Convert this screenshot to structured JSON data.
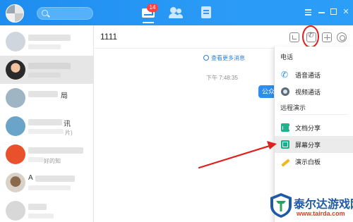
{
  "topbar": {
    "badge_count": "14",
    "accent": "#1e8df0"
  },
  "sidebar": {
    "items": [
      {
        "name": "",
        "subtitle": "",
        "selected": false
      },
      {
        "name": "",
        "subtitle": "",
        "selected": true
      },
      {
        "name": "局",
        "subtitle": "",
        "selected": false
      },
      {
        "name": "讯",
        "subtitle": "片)",
        "selected": false
      },
      {
        "name": "",
        "subtitle": "好的知",
        "selected": false
      },
      {
        "name": "A",
        "subtitle": "",
        "selected": false
      },
      {
        "name": "",
        "subtitle": "",
        "selected": false
      }
    ]
  },
  "chat": {
    "title": "1111",
    "more_messages": "查看更多消息",
    "timestamp": "下午 7:48:35",
    "bubble_text": "公众"
  },
  "menu": {
    "sections": [
      {
        "title": "电话",
        "items": [
          {
            "label": "语音通话",
            "icon": "phone-icon"
          },
          {
            "label": "视频通话",
            "icon": "video-camera-icon"
          }
        ]
      },
      {
        "title": "远程演示",
        "items": [
          {
            "label": "文档分享",
            "icon": "document-share-icon"
          },
          {
            "label": "屏幕分享",
            "icon": "screen-share-icon",
            "highlighted": true
          },
          {
            "label": "演示白板",
            "icon": "whiteboard-pen-icon"
          }
        ]
      }
    ]
  },
  "watermark": {
    "title": "泰尔达游戏网",
    "url": "www.tairda.com"
  },
  "annotation_color": "#e0201c"
}
